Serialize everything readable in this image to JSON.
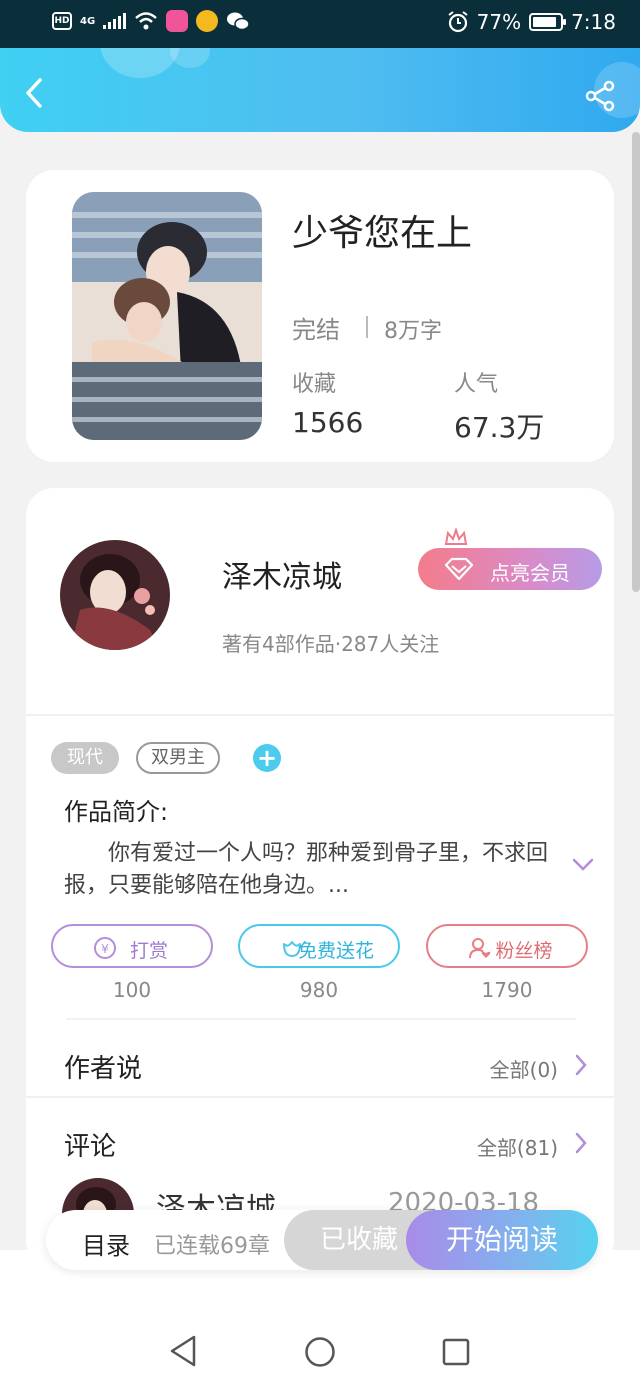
{
  "status_bar": {
    "network": "4G",
    "battery": "77%",
    "time": "7:18"
  },
  "header": {
    "back_icon": "chevron-left-icon",
    "share_icon": "share-icon"
  },
  "book": {
    "title": "少爷您在上",
    "status": "完结",
    "words": "8万字",
    "favorites_label": "收藏",
    "favorites_value": "1566",
    "popularity_label": "人气",
    "popularity_value": "67.3万"
  },
  "author": {
    "name": "泽木凉城",
    "meta": "著有4部作品·287人关注",
    "vip_button": "点亮会员"
  },
  "tags": [
    "现代",
    "双男主"
  ],
  "intro": {
    "title": "作品简介:",
    "text": "你有爱过一个人吗？那种爱到骨子里，不求回报，只要能够陪在他身边。..."
  },
  "actions": [
    {
      "label": "打赏",
      "count": "100",
      "icon": "coin-icon"
    },
    {
      "label": "免费送花",
      "count": "980",
      "icon": "flower-icon"
    },
    {
      "label": "粉丝榜",
      "count": "1790",
      "icon": "fans-icon"
    }
  ],
  "author_says": {
    "title": "作者说",
    "link": "全部(0)"
  },
  "comments": {
    "title": "评论",
    "link": "全部(81)",
    "first_user": "泽木凉城",
    "first_date": "2020-03-18"
  },
  "bottom_bar": {
    "toc": "目录",
    "serial": "已连载69章",
    "collected": "已收藏",
    "read": "开始阅读"
  },
  "colors": {
    "header_start": "#3fd0f2",
    "header_end": "#2fa9ef",
    "vip_start": "#f47c8a",
    "vip_end": "#b69be6",
    "tip": "#b48ddb",
    "flower": "#49c8e7",
    "fans": "#e77e86"
  }
}
